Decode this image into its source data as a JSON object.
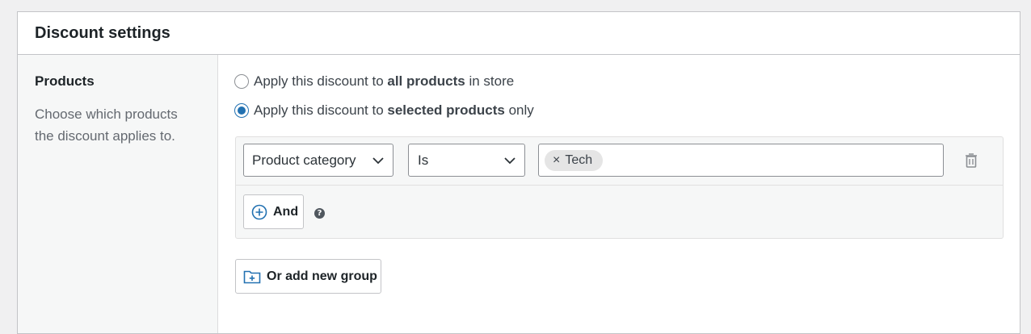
{
  "panel": {
    "title": "Discount settings"
  },
  "section": {
    "title": "Products",
    "description": "Choose which products the discount applies to."
  },
  "options": [
    {
      "prefix": "Apply this discount to ",
      "bold": "all products",
      "suffix": " in store",
      "checked": false
    },
    {
      "prefix": "Apply this discount to ",
      "bold": "selected products",
      "suffix": " only",
      "checked": true
    }
  ],
  "rule": {
    "field": "Product category",
    "operator": "Is",
    "tokens": [
      "Tech"
    ],
    "remove_token_glyph": "×",
    "delete_icon": "trash-icon"
  },
  "buttons": {
    "and_label": "And",
    "help_glyph": "?",
    "add_group_label": "Or add new group"
  },
  "colors": {
    "accent": "#2271b1",
    "text": "#3c434a",
    "border": "#c3c4c7"
  }
}
